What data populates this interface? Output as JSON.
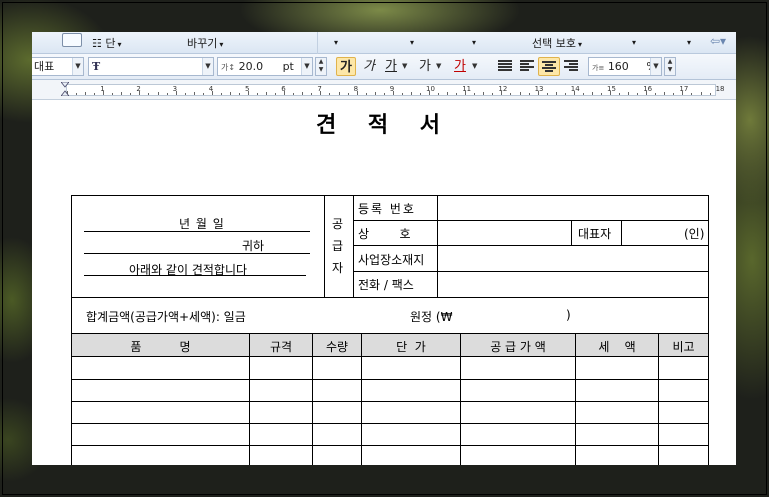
{
  "ribbon": {
    "items": [
      {
        "label": "단",
        "has_drop": true
      },
      {
        "label": "바꾸기",
        "has_drop": true
      },
      {
        "label": "선택 보호",
        "has_drop": true
      }
    ]
  },
  "format": {
    "style_value": "대표",
    "font_value": "",
    "size_value": "20.0",
    "size_unit": "pt",
    "bold": "가",
    "italic": "가",
    "underline": "가",
    "strike": "가",
    "color": "가",
    "line_spacing": "160",
    "line_spacing_unit": "%"
  },
  "ruler": {
    "numbers": [
      "1",
      "2",
      "3",
      "4",
      "5",
      "6",
      "7",
      "8",
      "9",
      "10",
      "11",
      "12",
      "13",
      "14",
      "15",
      "16",
      "17",
      "18"
    ]
  },
  "document": {
    "title": "견 적 서",
    "left_box": {
      "date": "년      월      일",
      "recipient": "귀하",
      "statement": "아래와 같이 견적합니다"
    },
    "supplier_label": [
      "공",
      "급",
      "자"
    ],
    "supplier_rows": [
      {
        "label": "등록 번호"
      },
      {
        "label": "상        호",
        "rep_label": "대표자",
        "seal": "(인)"
      },
      {
        "label": "사업장소재지"
      },
      {
        "label": "전화 / 팩스"
      }
    ],
    "total": {
      "label": "합계금액(공급가액+세액): 일금",
      "won": "원정 (₩",
      "close": ")"
    },
    "columns": [
      "품          명",
      "규격",
      "수량",
      "단  가",
      "공 급 가 액",
      "세    액",
      "비고"
    ],
    "empty_rows": 6
  }
}
